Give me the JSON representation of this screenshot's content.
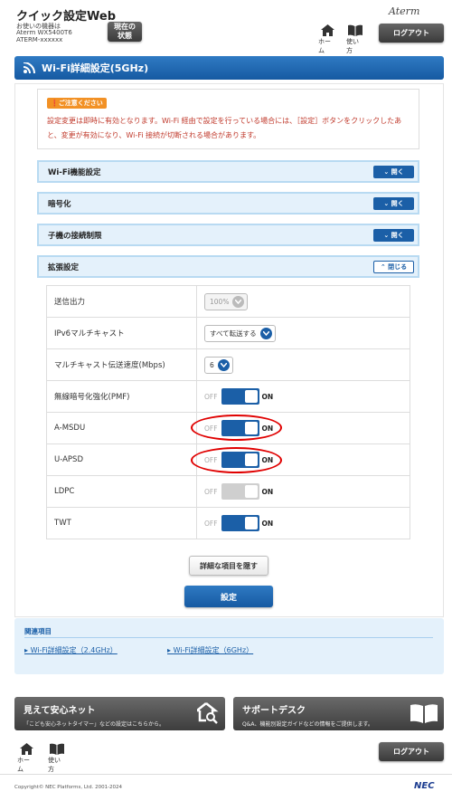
{
  "header": {
    "title": "クイック設定Web",
    "device_label": "お使いの機器は",
    "device_model": "Aterm WX5400T6",
    "device_id": "ATERM-xxxxxx",
    "status_button": "現在の\n状態",
    "logo": "Aterm",
    "home_label": "ホーム",
    "help_label": "使い方",
    "logout_label": "ログアウト"
  },
  "page_title": "Wi-Fi詳細設定(5GHz)",
  "notice": {
    "tag": "ご注意ください",
    "text": "設定変更は即時に有効となります。Wi-Fi 経由で設定を行っている場合には、［設定］ボタンをクリックしたあと、変更が有効になり、Wi-Fi 接続が切断される場合があります。"
  },
  "sections": [
    {
      "label": "Wi-Fi機能設定",
      "button": "開く"
    },
    {
      "label": "暗号化",
      "button": "開く"
    },
    {
      "label": "子機の接続制限",
      "button": "開く"
    },
    {
      "label": "拡張設定",
      "button": "閉じる"
    }
  ],
  "settings": {
    "tx_power": {
      "label": "送信出力",
      "value": "100%"
    },
    "ipv6_multicast": {
      "label": "IPv6マルチキャスト",
      "value": "すべて転送する"
    },
    "multicast_rate": {
      "label": "マルチキャスト伝送速度(Mbps)",
      "value": "6"
    },
    "pmf": {
      "label": "無線暗号化強化(PMF)",
      "off": "OFF",
      "on": "ON",
      "state": "on"
    },
    "amsdu": {
      "label": "A-MSDU",
      "off": "OFF",
      "on": "ON",
      "state": "on"
    },
    "uapsd": {
      "label": "U-APSD",
      "off": "OFF",
      "on": "ON",
      "state": "on"
    },
    "ldpc": {
      "label": "LDPC",
      "off": "OFF",
      "on": "ON",
      "state": "disabled"
    },
    "twt": {
      "label": "TWT",
      "off": "OFF",
      "on": "ON",
      "state": "on"
    }
  },
  "buttons": {
    "hide_details": "詳細な項目を隠す",
    "apply": "設定"
  },
  "related": {
    "title": "関連項目",
    "link1": "Wi-Fi詳細設定（2.4GHz）",
    "link2": "Wi-Fi詳細設定（6GHz）"
  },
  "banners": {
    "left_title": "見えて安心ネット",
    "left_sub": "「こども安心ネットタイマー」などの設定はこちらから。",
    "right_title": "サポートデスク",
    "right_sub": "Q&A、機能別設定ガイドなどの情報をご提供します。"
  },
  "footer": {
    "home_label": "ホーム",
    "help_label": "使い方",
    "logout_label": "ログアウト",
    "copyright": "Copyright© NEC Platforms, Ltd. 2001-2024",
    "brand": "NEC"
  },
  "colors": {
    "accent": "#1b5fa7",
    "highlight": "#e00000",
    "warning": "#f29125"
  }
}
